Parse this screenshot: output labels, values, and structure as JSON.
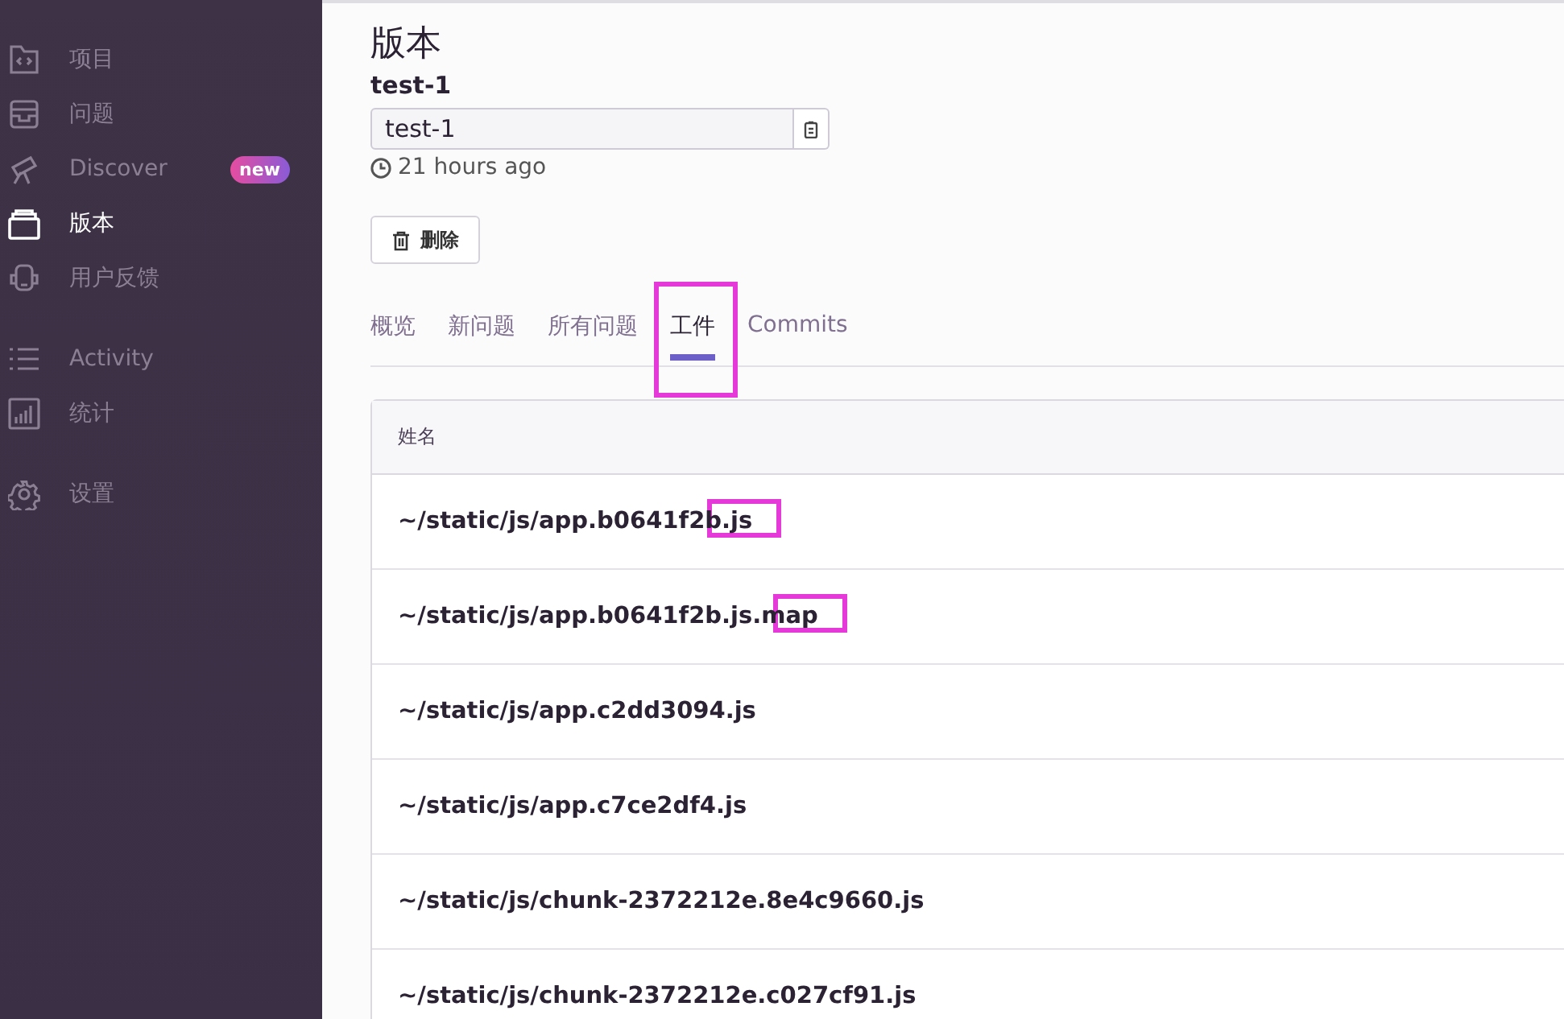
{
  "sidebar": {
    "groups": [
      {
        "items": [
          {
            "label": "项目",
            "selected": false
          },
          {
            "label": "问题",
            "selected": false
          },
          {
            "label": "Discover",
            "selected": false,
            "badge": "new"
          },
          {
            "label": "版本",
            "selected": true
          },
          {
            "label": "用户反馈",
            "selected": false
          }
        ]
      },
      {
        "items": [
          {
            "label": "Activity",
            "selected": false
          },
          {
            "label": "统计",
            "selected": false
          }
        ]
      },
      {
        "items": [
          {
            "label": "设置",
            "selected": false
          }
        ]
      }
    ]
  },
  "page_title": "版本",
  "release_name": "test-1",
  "version_field": {
    "value": "test-1"
  },
  "time": "21 hours ago",
  "delete_button": "删除",
  "tabs": [
    {
      "label": "概览",
      "selected": false,
      "highlighted": false
    },
    {
      "label": "新问题",
      "selected": false,
      "highlighted": false
    },
    {
      "label": "所有问题",
      "selected": false,
      "highlighted": false
    },
    {
      "label": "工件",
      "selected": true,
      "highlighted": true
    },
    {
      "label": "Commits",
      "selected": false,
      "highlighted": false
    }
  ],
  "table": {
    "columns": [
      "姓名"
    ],
    "rows": [
      {
        "name": "~/static/js/app.b0641f2b.js",
        "highlighted": true
      },
      {
        "name": "~/static/js/app.b0641f2b.js.map",
        "highlighted": true
      },
      {
        "name": "~/static/js/app.c2dd3094.js",
        "highlighted": false
      },
      {
        "name": "~/static/js/app.c7ce2df4.js",
        "highlighted": false
      },
      {
        "name": "~/static/js/chunk-2372212e.8e4c9660.js",
        "highlighted": false
      },
      {
        "name": "~/static/js/chunk-2372212e.c027cf91.js",
        "highlighted": false
      }
    ]
  }
}
